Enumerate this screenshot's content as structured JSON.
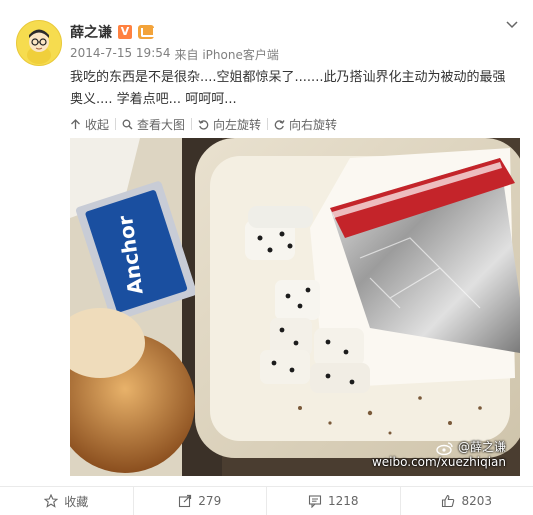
{
  "post": {
    "author": "薛之谦",
    "verified_badge": "V",
    "timestamp": "2014-7-15 19:54",
    "source": "来自 iPhone客户端",
    "text": "我吃的东西是不是很杂....空姐都惊呆了.......此乃搭讪界化主动为被动的最强奥义.... 学着点吧... 呵呵呵..."
  },
  "toolbar": {
    "collapse": "收起",
    "view_large": "查看大图",
    "rotate_left": "向左旋转",
    "rotate_right": "向右旋转"
  },
  "photo": {
    "butter_brand": "Anchor",
    "watermark_name": "@薛之谦",
    "watermark_url": "weibo.com/xuezhiqian"
  },
  "actions": {
    "favorite": "收藏",
    "repost_count": "279",
    "comment_count": "1218",
    "like_count": "8203"
  },
  "colors": {
    "accent_orange": "#ff8140",
    "text_gray": "#808080",
    "butter_blue": "#1a4fa0"
  }
}
